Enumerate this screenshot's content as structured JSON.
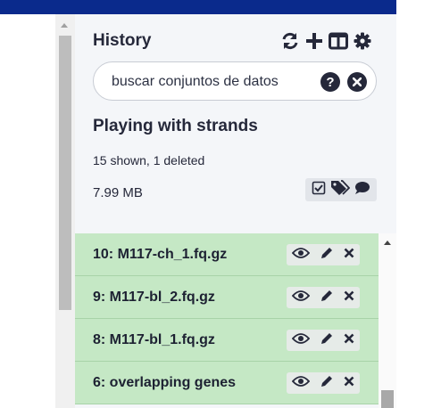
{
  "history": {
    "title": "History",
    "header_icons": [
      "refresh-icon",
      "plus-icon",
      "columns-icon",
      "gear-icon"
    ],
    "search_placeholder": "buscar conjuntos de datos",
    "name": "Playing with strands",
    "counts": "15 shown, 1 deleted",
    "size": "7.99 MB",
    "small_icons": [
      "checkbox-icon",
      "tags-icon",
      "comment-icon"
    ]
  },
  "datasets": [
    {
      "label": "10: M117-ch_1.fq.gz"
    },
    {
      "label": "9: M117-bl_2.fq.gz"
    },
    {
      "label": "8: M117-bl_1.fq.gz"
    },
    {
      "label": "6: overlapping genes"
    }
  ],
  "colors": {
    "topbar": "#0a2a8c",
    "panel_bg": "#f4f6f9",
    "dataset_ok": "#c5e8c5",
    "text": "#25283a"
  }
}
